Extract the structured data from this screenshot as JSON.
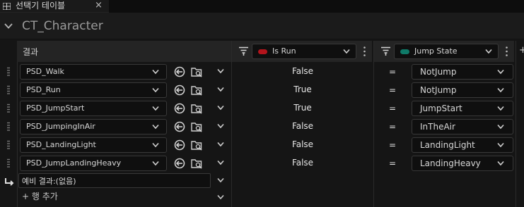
{
  "tab": {
    "title": "선택기 테이블",
    "close": "×"
  },
  "asset": {
    "title": "CT_Character"
  },
  "table": {
    "result_header": "결과",
    "columns": [
      {
        "label": "Is Run",
        "color": "#b3141c"
      },
      {
        "label": "Jump State",
        "color": "#0f7a68"
      }
    ],
    "add_column": "+",
    "rows": [
      {
        "result": "PSD_Walk",
        "is_run": "False",
        "op": "=",
        "jump_state": "NotJump"
      },
      {
        "result": "PSD_Run",
        "is_run": "True",
        "op": "=",
        "jump_state": "NotJump"
      },
      {
        "result": "PSD_JumpStart",
        "is_run": "True",
        "op": "=",
        "jump_state": "JumpStart"
      },
      {
        "result": "PSD_JumpingInAir",
        "is_run": "False",
        "op": "=",
        "jump_state": "InTheAir"
      },
      {
        "result": "PSD_LandingLight",
        "is_run": "False",
        "op": "=",
        "jump_state": "LandingLight"
      },
      {
        "result": "PSD_JumpLandingHeavy",
        "is_run": "False",
        "op": "=",
        "jump_state": "LandingHeavy"
      }
    ],
    "fallback": "예비 결과:(없음)",
    "add_row": "+ 행 추가"
  },
  "icons": {
    "tab": "table-grid-icon",
    "collapse": "chevron-down-icon",
    "filter": "filter-icon",
    "kebab": "kebab-menu-icon",
    "back": "back-arrow-icon",
    "browse": "browse-folder-icon",
    "handle": "drag-handle-icon",
    "fallback": "return-arrow-icon"
  }
}
